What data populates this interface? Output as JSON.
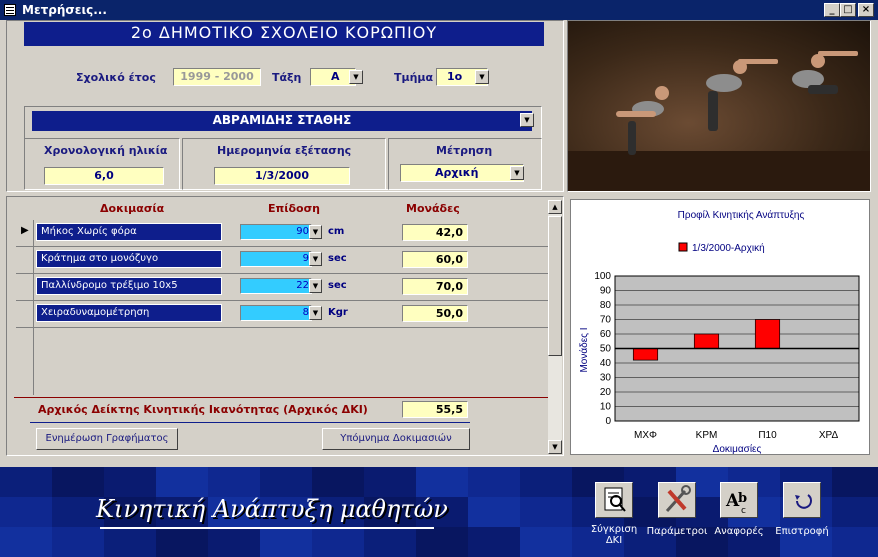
{
  "window": {
    "title": "Μετρήσεις..."
  },
  "school": {
    "name": "2ο ΔΗΜΟΤΙΚΟ ΣΧΟΛΕΙΟ ΚΟΡΩΠΙΟΥ"
  },
  "filters": {
    "year_label": "Σχολικό έτος",
    "year_value": "1999 - 2000",
    "class_label": "Τάξη",
    "class_value": "Α",
    "section_label": "Τμήμα",
    "section_value": "1ο"
  },
  "student": {
    "name": "ΑΒΡΑΜΙΔΗΣ ΣΤΑΘΗΣ",
    "age_label": "Χρονολογική ηλικία",
    "age_value": "6,0",
    "date_label": "Ημερομηνία εξέτασης",
    "date_value": "1/3/2000",
    "measure_label": "Μέτρηση",
    "measure_value": "Αρχική"
  },
  "grid": {
    "headers": {
      "test": "Δοκιμασία",
      "performance": "Επίδοση",
      "units": "Μονάδες"
    },
    "rows": [
      {
        "test": "Μήκος Χωρίς φόρα",
        "performance": "90",
        "unit": "cm",
        "score": "42,0"
      },
      {
        "test": "Κράτημα στο μονόζυγο",
        "performance": "9",
        "unit": "sec",
        "score": "60,0"
      },
      {
        "test": "Παλλίνδρομο τρέξιμο 10x5",
        "performance": "22",
        "unit": "sec",
        "score": "70,0"
      },
      {
        "test": "Χειραδυναμομέτρηση",
        "performance": "8",
        "unit": "Kgr",
        "score": "50,0"
      }
    ]
  },
  "index": {
    "label": "Αρχικός Δείκτης Κινητικής Ικανότητας (Αρχικός ΔΚΙ)",
    "value": "55,5"
  },
  "buttons": {
    "update_chart": "Ενημέρωση Γραφήματος",
    "legend": "Υπόμνημα Δοκιμασιών"
  },
  "footer": {
    "title": "Κινητική Ανάπτυξη μαθητών",
    "compare": "Σύγκριση ΔΚΙ",
    "params": "Παράμετροι",
    "reports": "Αναφορές",
    "back": "Επιστροφή"
  },
  "chart_data": {
    "type": "bar",
    "title": "Προφίλ Κινητικής Ανάπτυξης",
    "categories": [
      "ΜΧΦ",
      "ΚΡΜ",
      "Π10",
      "ΧΡΔ"
    ],
    "series": [
      {
        "name": "1/3/2000-Αρχική",
        "values": [
          42,
          60,
          70,
          50
        ]
      }
    ],
    "baseline": 50,
    "xlabel": "Δοκιμασίες",
    "ylabel": "Μονάδες Ι",
    "ylim": [
      0,
      100
    ],
    "yticks": [
      "0",
      "10",
      "20",
      "30",
      "40",
      "50",
      "60",
      "70",
      "80",
      "90",
      "100"
    ],
    "bar_color": "#ff0000",
    "grid": true,
    "legend": "top"
  }
}
